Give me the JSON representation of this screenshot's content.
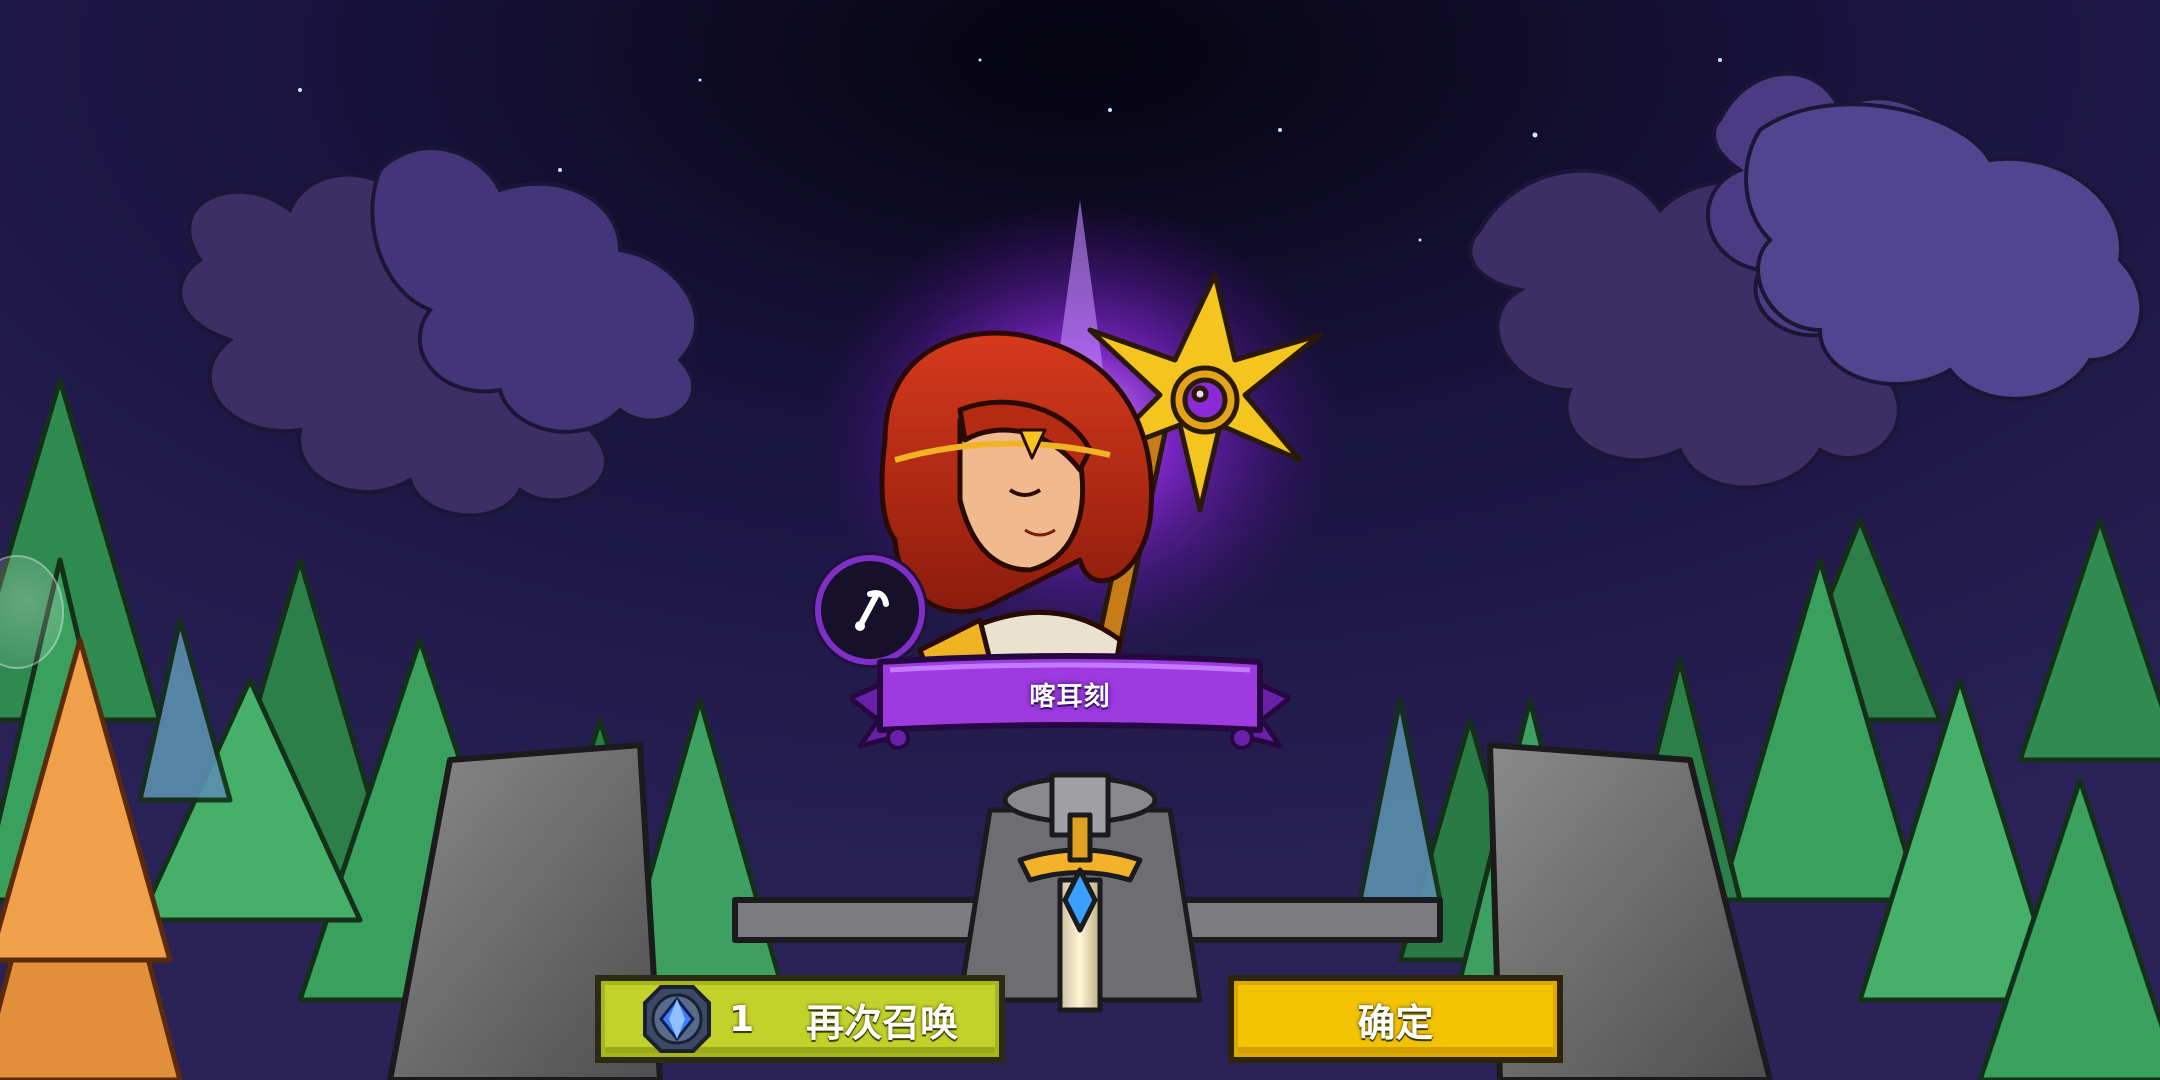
{
  "hero": {
    "name": "喀耳刻",
    "class_icon": "staff-icon"
  },
  "actions": {
    "resummon": {
      "icon": "gem-icon",
      "cost": "1",
      "label": "再次召唤"
    },
    "confirm": {
      "label": "确定"
    }
  },
  "colors": {
    "banner": "#9d3be0",
    "resummon_button": "#c3d22a",
    "confirm_button": "#f3c200",
    "sky": "#0c0a1e"
  }
}
